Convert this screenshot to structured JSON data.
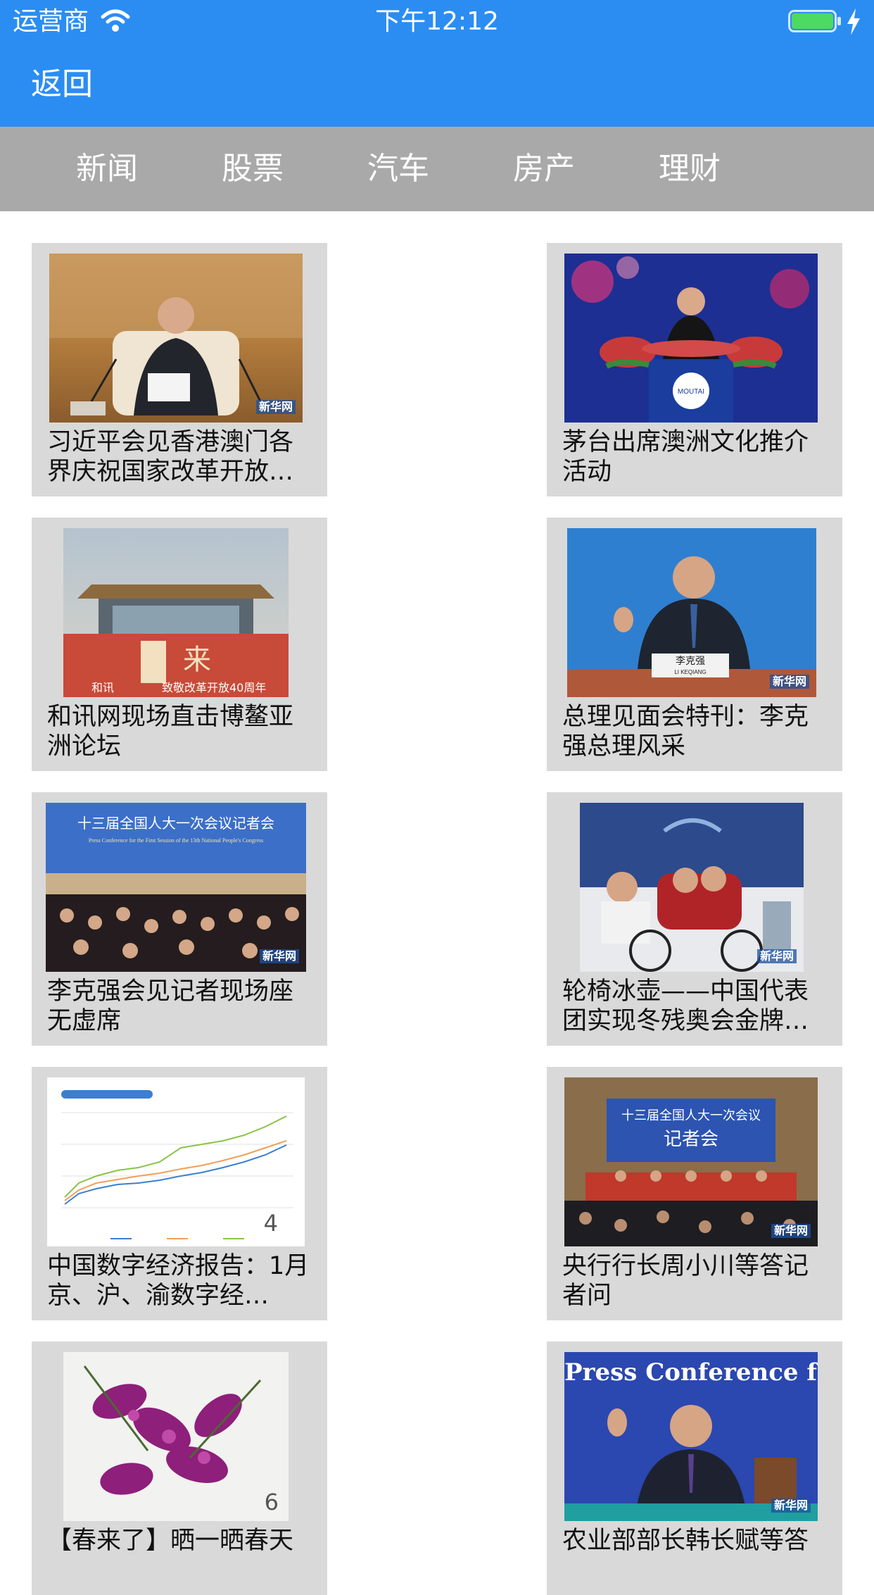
{
  "status_bar": {
    "carrier": "运营商",
    "time": "下午12:12"
  },
  "nav": {
    "back_label": "返回"
  },
  "tabs": [
    "新闻",
    "股票",
    "汽车",
    "房产",
    "理财"
  ],
  "colors": {
    "primary": "#2b8df2",
    "tab_bar": "#a9a9a9",
    "card_bg": "#d9d9d9",
    "battery": "#4cd964"
  },
  "cards": [
    {
      "caption": "习近平会见香港澳门各界庆祝国家改革开放…",
      "watermark": "新华网"
    },
    {
      "caption": "茅台出席澳洲文化推介活动",
      "podium_text": "MOUTAI"
    },
    {
      "caption": "和讯网现场直击博鳌亚洲论坛",
      "logo": "和讯",
      "banner": "致敬改革开放40周年",
      "sign": "来"
    },
    {
      "caption": "总理见面会特刊：李克强总理风采",
      "nameplate": "李克强",
      "nameplate_sub": "LI KEQIANG",
      "watermark": "新华网"
    },
    {
      "caption": "李克强会见记者现场座无虚席",
      "banner": "十三届全国人大一次会议记者会",
      "banner_sub": "Press Conference for the First Session of the 13th National People's Congress",
      "watermark": "新华网"
    },
    {
      "caption": "轮椅冰壶——中国代表团实现冬残奥会金牌…",
      "watermark": "新华网"
    },
    {
      "caption": "中国数字经济报告：1月京、沪、渝数字经…",
      "overlay_number": "4"
    },
    {
      "caption": "央行行长周小川等答记者问",
      "banner": "十三届全国人大一次会议",
      "banner_big": "记者会",
      "watermark": "新华网"
    },
    {
      "caption": "【春来了】晒一晒春天",
      "overlay_number": "6"
    },
    {
      "caption": "农业部部长韩长赋等答",
      "banner": "Press Conference for th",
      "watermark": "新华网"
    }
  ]
}
